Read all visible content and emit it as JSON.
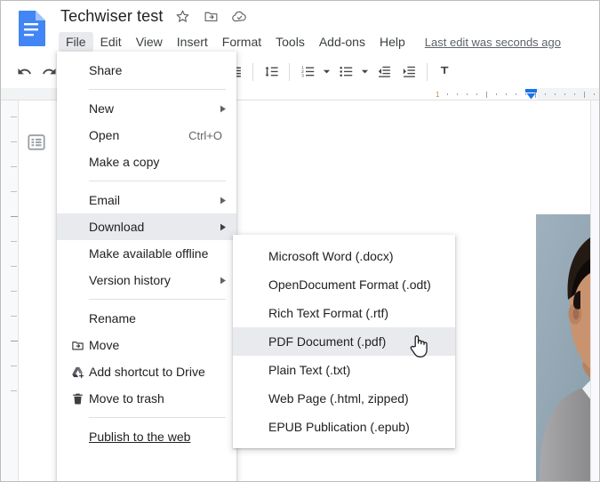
{
  "app": {
    "logo_icon": "google-docs-icon",
    "doc_title": "Techwiser test",
    "title_icons": [
      {
        "name": "star-icon",
        "label": "Star"
      },
      {
        "name": "move-to-folder-icon",
        "label": "Move to folder"
      },
      {
        "name": "cloud-saved-icon",
        "label": "Saved to Drive"
      }
    ],
    "last_edit": "Last edit was seconds ago"
  },
  "menubar": {
    "items": [
      {
        "label": "File",
        "active": true
      },
      {
        "label": "Edit",
        "active": false
      },
      {
        "label": "View",
        "active": false
      },
      {
        "label": "Insert",
        "active": false
      },
      {
        "label": "Format",
        "active": false
      },
      {
        "label": "Tools",
        "active": false
      },
      {
        "label": "Add-ons",
        "active": false
      },
      {
        "label": "Help",
        "active": false
      }
    ]
  },
  "toolbar": {
    "items": [
      {
        "name": "undo-icon",
        "type": "button",
        "selected": false
      },
      {
        "name": "redo-icon",
        "type": "button",
        "selected": false
      },
      {
        "name": "add-comment-icon",
        "type": "button",
        "selected": false
      },
      {
        "name": "insert-image-icon",
        "type": "button",
        "selected": false
      },
      {
        "name": "insert-image-caret-icon",
        "type": "caret",
        "selected": false
      },
      {
        "name": "separator",
        "type": "sep",
        "selected": false
      },
      {
        "name": "align-left-icon",
        "type": "button",
        "selected": true
      },
      {
        "name": "align-center-icon",
        "type": "button",
        "selected": false
      },
      {
        "name": "align-right-icon",
        "type": "button",
        "selected": false
      },
      {
        "name": "align-justify-icon",
        "type": "button",
        "selected": false
      },
      {
        "name": "separator",
        "type": "sep",
        "selected": false
      },
      {
        "name": "line-spacing-icon",
        "type": "button",
        "selected": false
      },
      {
        "name": "separator",
        "type": "sep",
        "selected": false
      },
      {
        "name": "numbered-list-icon",
        "type": "button",
        "selected": false
      },
      {
        "name": "numbered-list-caret-icon",
        "type": "caret",
        "selected": false
      },
      {
        "name": "bulleted-list-icon",
        "type": "button",
        "selected": false
      },
      {
        "name": "bulleted-list-caret-icon",
        "type": "caret",
        "selected": false
      },
      {
        "name": "decrease-indent-icon",
        "type": "button",
        "selected": false
      },
      {
        "name": "increase-indent-icon",
        "type": "button",
        "selected": false
      },
      {
        "name": "separator",
        "type": "sep",
        "selected": false
      },
      {
        "name": "clear-formatting-icon",
        "type": "button",
        "selected": false
      }
    ]
  },
  "ruler": {
    "marker_number": "1"
  },
  "file_menu": {
    "items": [
      {
        "label": "Share",
        "icon": null,
        "shortcut": null,
        "arrow": false,
        "highlight": false,
        "underline": false
      },
      {
        "type": "separator"
      },
      {
        "label": "New",
        "icon": null,
        "shortcut": null,
        "arrow": true,
        "highlight": false,
        "underline": false
      },
      {
        "label": "Open",
        "icon": null,
        "shortcut": "Ctrl+O",
        "arrow": false,
        "highlight": false,
        "underline": false
      },
      {
        "label": "Make a copy",
        "icon": null,
        "shortcut": null,
        "arrow": false,
        "highlight": false,
        "underline": false
      },
      {
        "type": "separator"
      },
      {
        "label": "Email",
        "icon": null,
        "shortcut": null,
        "arrow": true,
        "highlight": false,
        "underline": false
      },
      {
        "label": "Download",
        "icon": null,
        "shortcut": null,
        "arrow": true,
        "highlight": true,
        "underline": false
      },
      {
        "label": "Make available offline",
        "icon": null,
        "shortcut": null,
        "arrow": false,
        "highlight": false,
        "underline": false
      },
      {
        "label": "Version history",
        "icon": null,
        "shortcut": null,
        "arrow": true,
        "highlight": false,
        "underline": false
      },
      {
        "type": "separator"
      },
      {
        "label": "Rename",
        "icon": null,
        "shortcut": null,
        "arrow": false,
        "highlight": false,
        "underline": false
      },
      {
        "label": "Move",
        "icon": "move-to-folder-icon",
        "shortcut": null,
        "arrow": false,
        "highlight": false,
        "underline": false
      },
      {
        "label": "Add shortcut to Drive",
        "icon": "add-shortcut-drive-icon",
        "shortcut": null,
        "arrow": false,
        "highlight": false,
        "underline": false
      },
      {
        "label": "Move to trash",
        "icon": "trash-icon",
        "shortcut": null,
        "arrow": false,
        "highlight": false,
        "underline": false
      },
      {
        "type": "separator"
      },
      {
        "label": "Publish to the web",
        "icon": null,
        "shortcut": null,
        "arrow": false,
        "highlight": false,
        "underline": true
      }
    ]
  },
  "download_submenu": {
    "items": [
      {
        "label": "Microsoft Word (.docx)",
        "highlight": false
      },
      {
        "label": "OpenDocument Format (.odt)",
        "highlight": false
      },
      {
        "label": "Rich Text Format (.rtf)",
        "highlight": false
      },
      {
        "label": "PDF Document (.pdf)",
        "highlight": true
      },
      {
        "label": "Plain Text (.txt)",
        "highlight": false
      },
      {
        "label": "Web Page (.html, zipped)",
        "highlight": false
      },
      {
        "label": "EPUB Publication (.epub)",
        "highlight": false
      }
    ]
  },
  "document": {
    "outline_icon": "document-outline-icon",
    "image": {
      "name": "person-photo",
      "alt": "Photo of a man in a grey sweater"
    }
  },
  "cursor": {
    "name": "pointer-hand-cursor"
  },
  "colors": {
    "accent_blue": "#1a73e8",
    "docs_blue": "#4285f4",
    "toolbar_selected": "#d2e3fc",
    "menu_highlight": "#e8eaed",
    "text_primary": "#202124",
    "text_secondary": "#5f6368",
    "workspace_bg": "#f8f9fa",
    "ruler_bg": "#f1f3f4"
  }
}
